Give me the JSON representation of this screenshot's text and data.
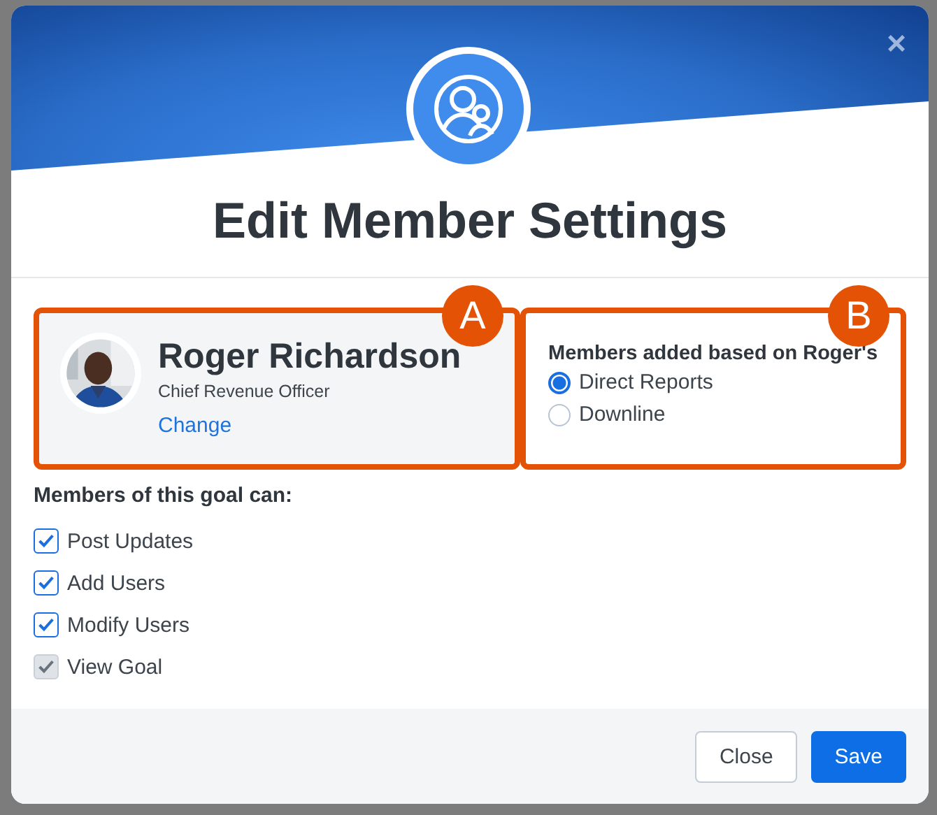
{
  "dialog": {
    "title": "Edit Member Settings",
    "close": "×"
  },
  "member": {
    "name": "Roger Richardson",
    "role": "Chief Revenue Officer",
    "change_link": "Change",
    "badge": "A"
  },
  "membership": {
    "heading": "Members added based on Roger's",
    "badge": "B",
    "options": [
      {
        "label": "Direct Reports",
        "selected": true
      },
      {
        "label": "Downline",
        "selected": false
      }
    ]
  },
  "permissions": {
    "heading": "Members of this goal can:",
    "items": [
      {
        "label": "Post Updates",
        "checked": true,
        "disabled": false
      },
      {
        "label": "Add Users",
        "checked": true,
        "disabled": false
      },
      {
        "label": "Modify Users",
        "checked": true,
        "disabled": false
      },
      {
        "label": "View Goal",
        "checked": true,
        "disabled": true
      }
    ]
  },
  "buttons": [
    {
      "label": "Close",
      "kind": "secondary"
    },
    {
      "label": "Save",
      "kind": "primary"
    }
  ]
}
